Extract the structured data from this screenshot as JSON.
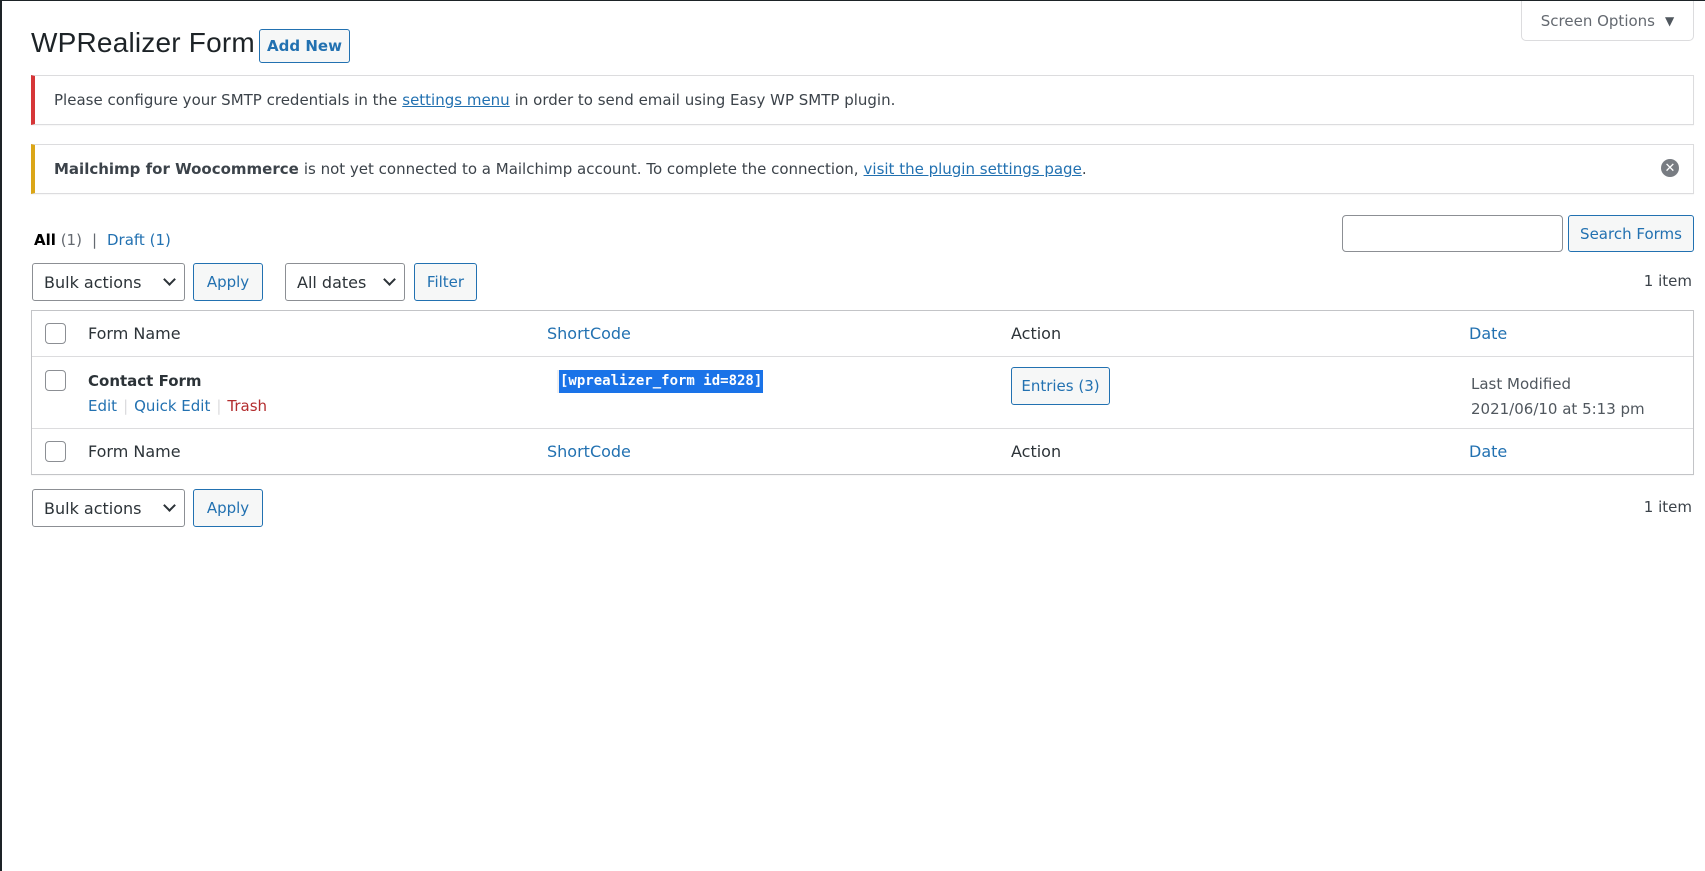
{
  "header": {
    "screen_options_label": "Screen Options",
    "page_title": "WPRealizer Form",
    "add_new_label": "Add New"
  },
  "notices": [
    {
      "type": "error",
      "color": "#d63638",
      "text_before": "Please configure your SMTP credentials in the",
      "link_text": "settings menu",
      "text_after": "in order to send email using Easy WP SMTP plugin."
    },
    {
      "type": "warning",
      "color": "#dba617",
      "bold_text": "Mailchimp for Woocommerce",
      "text_before": "is not yet connected to a Mailchimp account. To complete the connection,",
      "link_text": "visit the plugin settings page",
      "text_after": ".",
      "dismiss_icon": "dismiss-circle-icon"
    }
  ],
  "views": {
    "all_label": "All",
    "all_count": "(1)",
    "separator": "|",
    "draft_label": "Draft",
    "draft_count": "(1)"
  },
  "search": {
    "value": "",
    "placeholder": "",
    "button_label": "Search Forms"
  },
  "tablenav_top": {
    "bulk_actions": "Bulk actions",
    "apply_label": "Apply",
    "dates_filter": "All dates",
    "filter_label": "Filter",
    "items_count": "1 item"
  },
  "table": {
    "columns": [
      "Form Name",
      "ShortCode",
      "Action",
      "Date"
    ],
    "rows": [
      {
        "form_name": "Contact Form",
        "row_actions": [
          "Edit",
          "Quick Edit",
          "Trash"
        ],
        "shortcode": "[wprealizer_form id=828]",
        "action_button": "Entries (3)",
        "date_status": "Last Modified",
        "date_value": "2021/06/10 at 5:13 pm"
      }
    ]
  },
  "tablenav_bottom": {
    "bulk_actions": "Bulk actions",
    "apply_label": "Apply",
    "items_count": "1 item"
  },
  "colors": {
    "link": "#2271b1",
    "trash": "#b32d2e",
    "selection": "#1a73e8"
  }
}
